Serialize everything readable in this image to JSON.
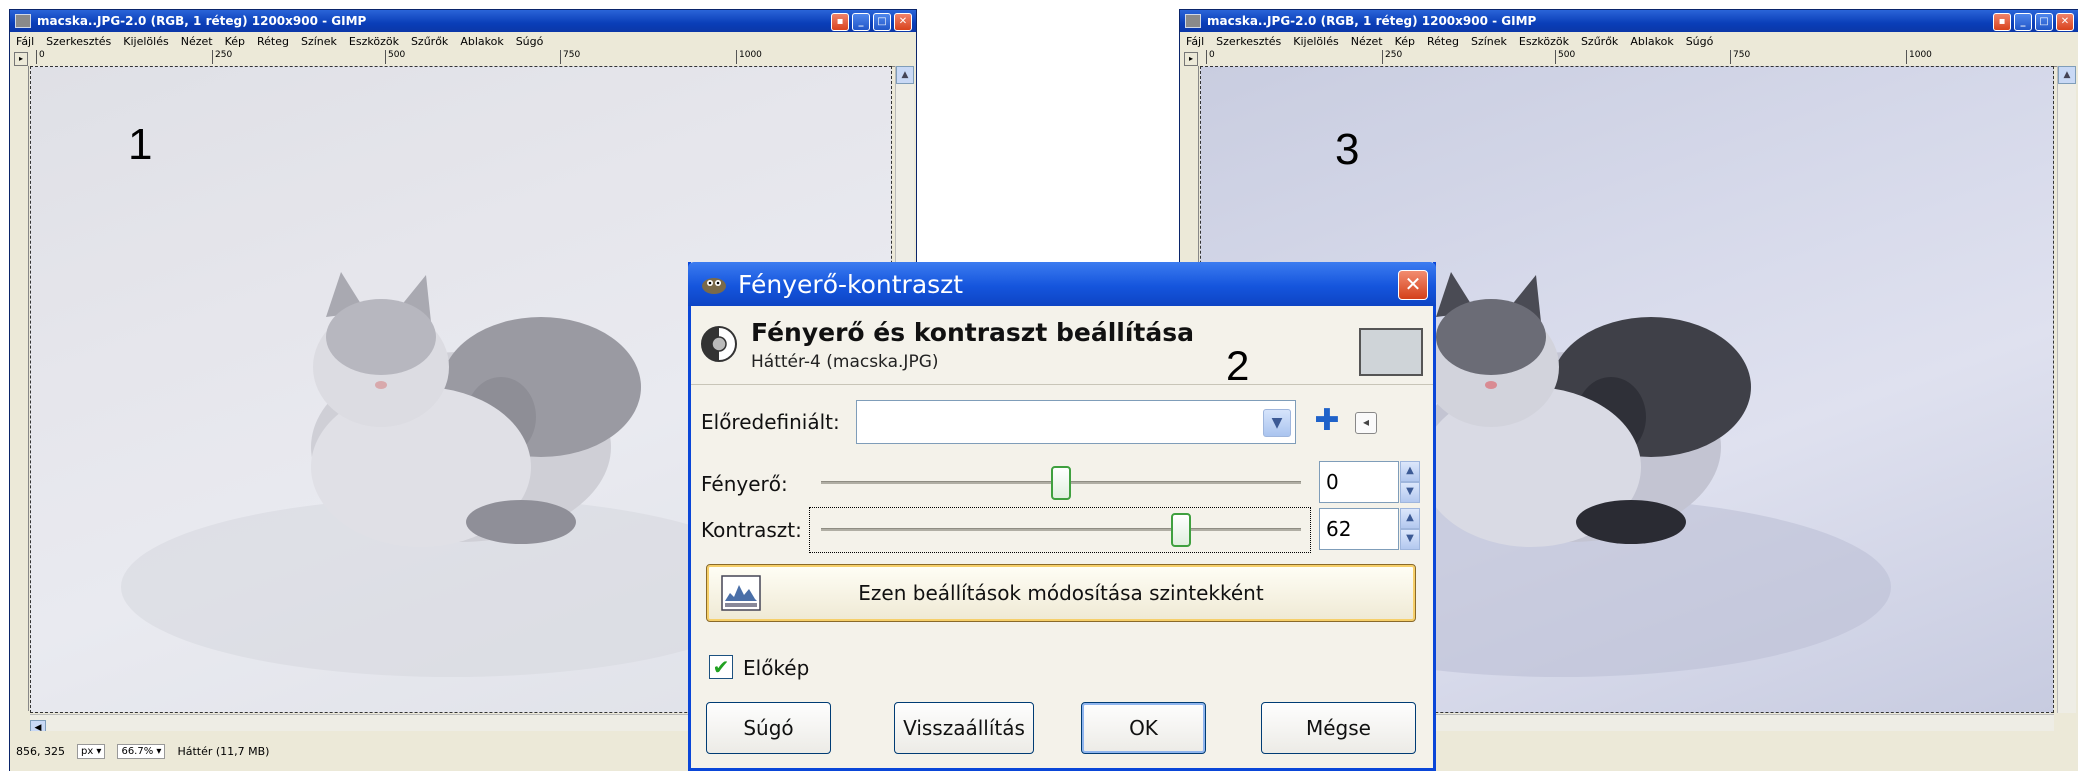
{
  "left_window": {
    "title": "macska..JPG-2.0 (RGB, 1 réteg) 1200x900 - GIMP",
    "menu": [
      "Fájl",
      "Szerkesztés",
      "Kijelölés",
      "Nézet",
      "Kép",
      "Réteg",
      "Színek",
      "Eszközök",
      "Szűrők",
      "Ablakok",
      "Súgó"
    ],
    "ruler_ticks": [
      "0",
      "250",
      "500",
      "750",
      "1000"
    ],
    "coords": "856, 325",
    "unit": "px",
    "zoom": "66.7%",
    "layer_status": "Háttér (11,7 MB)",
    "overlay_number": "1"
  },
  "right_window": {
    "title": "macska..JPG-2.0 (RGB, 1 réteg) 1200x900 - GIMP",
    "menu": [
      "Fájl",
      "Szerkesztés",
      "Kijelölés",
      "Nézet",
      "Kép",
      "Réteg",
      "Színek",
      "Eszközök",
      "Szűrők",
      "Ablakok",
      "Súgó"
    ],
    "ruler_ticks": [
      "0",
      "250",
      "500",
      "750",
      "1000"
    ],
    "overlay_number": "3"
  },
  "dialog": {
    "title": "Fényerő-kontraszt",
    "heading": "Fényerő és kontraszt beállítása",
    "subheading": "Háttér-4 (macska.JPG)",
    "overlay_number": "2",
    "preset_label": "Előredefiniált:",
    "preset_value": "",
    "brightness_label": "Fényerő:",
    "brightness_value": "0",
    "brightness_level": 0.5,
    "contrast_label": "Kontraszt:",
    "contrast_value": "62",
    "contrast_level": 0.75,
    "levels_button": "Ezen beállítások módosítása szintekként",
    "preview_label": "Előkép",
    "preview_checked": true,
    "buttons": {
      "help": "Súgó",
      "reset": "Visszaállítás",
      "ok": "OK",
      "cancel": "Mégse"
    }
  },
  "colors": {
    "titlebar": "#0a3eb8",
    "dialog_border": "#0a46d8",
    "slider_thumb": "#3fa03f"
  }
}
